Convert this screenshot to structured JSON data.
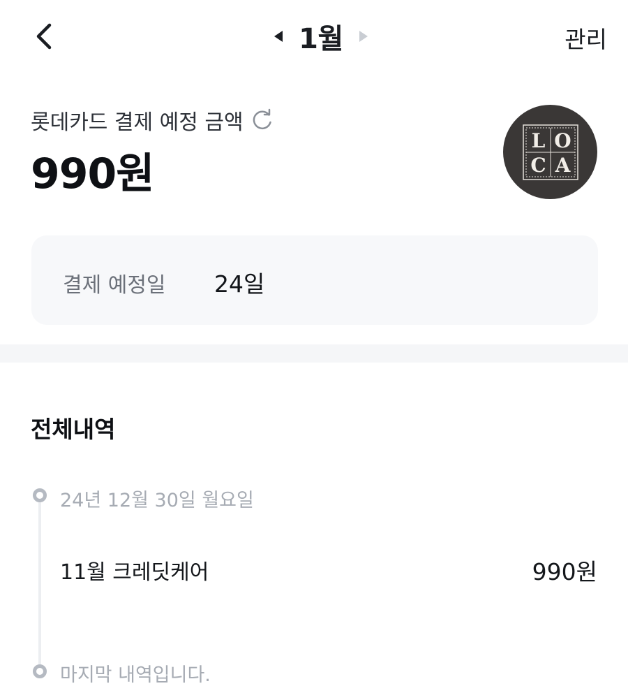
{
  "header": {
    "month": "1월",
    "manage_label": "관리"
  },
  "summary": {
    "label": "롯데카드 결제 예정 금액",
    "amount": "990원"
  },
  "card": {
    "logo_letters": [
      "L",
      "O",
      "C",
      "A"
    ]
  },
  "due": {
    "label": "결제 예정일",
    "value": "24일"
  },
  "history": {
    "title": "전체내역",
    "groups": [
      {
        "date": "24년 12월 30일 월요일",
        "items": [
          {
            "name": "11월 크레딧케어",
            "amount": "990원"
          }
        ]
      }
    ],
    "end_label": "마지막 내역입니다."
  },
  "colors": {
    "text_primary": "#111418",
    "text_muted": "#a6abb3",
    "box_bg": "#f7f8fa",
    "logo_bg": "#3a3736"
  }
}
